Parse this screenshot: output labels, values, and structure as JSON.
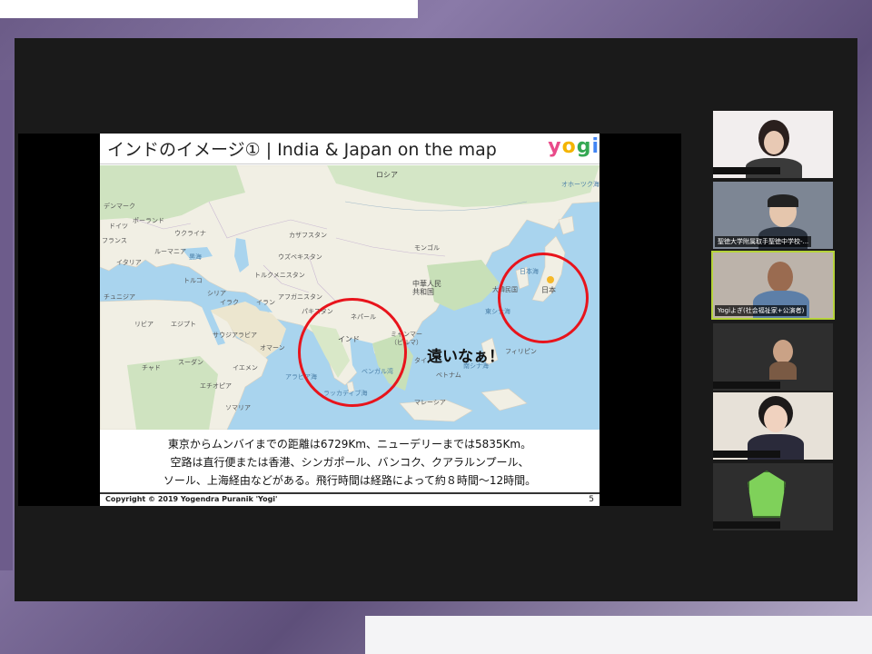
{
  "slide": {
    "title": "インドのイメージ① | India & Japan on the map",
    "logo_letters": [
      "y",
      "o",
      "g",
      "i"
    ],
    "far_text": "遠いなぁ！",
    "caption_lines": [
      "東京からムンバイまでの距離は6729Km、ニューデリーまでは5835Km。",
      "空路は直行便または香港、シンガポール、バンコク、クアラルンプール、",
      "ソール、上海経由などがある。飛行時間は経路によって約８時間〜12時間。"
    ],
    "copyright": "Copyright © 2019 Yogendra Puranik 'Yogi'",
    "page_number": "5"
  },
  "map_labels": {
    "russia": "ロシア",
    "denmark": "デンマーク",
    "germany": "ドイツ",
    "poland": "ポーランド",
    "ukraine": "ウクライナ",
    "france": "フランス",
    "italy": "イタリア",
    "romania": "ルーマニア",
    "kazakhstan": "カザフスタン",
    "uzbekistan": "ウズベキスタン",
    "turkmenistan": "トルクメニスタン",
    "mongolia": "モンゴル",
    "turkey": "トルコ",
    "tunisia": "チュニジア",
    "syria": "シリア",
    "iraq": "イラク",
    "iran": "イラン",
    "afghanistan": "アフガニスタン",
    "pakistan": "パキスタン",
    "nepal": "ネパール",
    "india": "インド",
    "china": "中華人民\n共和国",
    "korea": "大韓民国",
    "japan": "日本",
    "sea_of_japan": "日本海",
    "libya": "リビア",
    "egypt": "エジプト",
    "saudi": "サウジアラビア",
    "oman": "オマーン",
    "sudan": "スーダン",
    "chad": "チャド",
    "yemen": "イエメン",
    "ethiopia": "エチオピア",
    "somalia": "ソマリア",
    "myanmar": "ミャンマー\n（ビルマ）",
    "thailand": "タイ",
    "vietnam": "ベトナム",
    "philippines": "フィリピン",
    "malaysia": "マレーシア",
    "arabian_sea": "アラビア海",
    "bay_of_bengal": "ベンガル湾",
    "laccadive": "ラッカディブ海",
    "south_china_sea": "南シナ海",
    "east_china_sea": "東シナ海",
    "okhotsk": "オホーツク海",
    "black_sea": "黒海"
  },
  "participants": [
    {
      "name": "",
      "label_hidden": true
    },
    {
      "name": "聖徳大学附属取手聖徳中学校-..."
    },
    {
      "name": "Yogiよぎ(社会福祉家+公演者)",
      "active": true
    },
    {
      "name": "",
      "label_hidden": true
    },
    {
      "name": "",
      "label_hidden": true
    },
    {
      "name": "",
      "label_hidden": true
    }
  ],
  "colors": {
    "highlight_circle": "#e8141c",
    "active_speaker": "#b5d33a"
  }
}
